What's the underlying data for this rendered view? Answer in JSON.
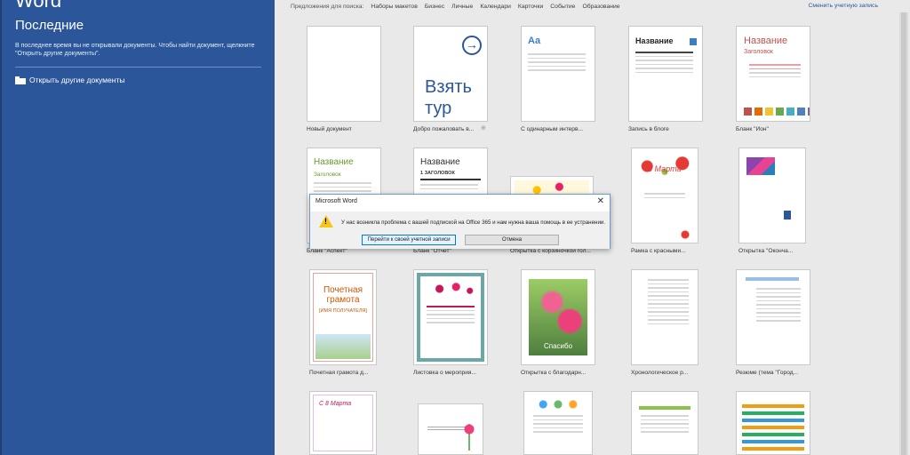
{
  "left": {
    "app_title": "Word",
    "recent_title": "Последние",
    "recent_desc": "В последнее время вы не открывали документы. Чтобы найти документ, щелкните \"Открыть другие документы\".",
    "open_other": "Открыть другие документы"
  },
  "topbar": {
    "suggest_label": "Предложения для поиска:",
    "links": [
      "Наборы макетов",
      "Бизнес",
      "Личные",
      "Календари",
      "Карточки",
      "Событие",
      "Образование"
    ],
    "switch_account": "Сменить учетную запись"
  },
  "templates": [
    {
      "caption": "Новый документ"
    },
    {
      "caption": "Добро пожаловать в...",
      "text": "Взять тур"
    },
    {
      "caption": "С одинарным интерв...",
      "text": "Aa"
    },
    {
      "caption": "Запись в блоге",
      "text": "Название"
    },
    {
      "caption": "Бланк \"Ион\"",
      "text": "Название",
      "sub": "Заголовок"
    },
    {
      "caption": "Бланк \"Аспект\"",
      "text": "Название",
      "sub": "Заголовок"
    },
    {
      "caption": "Бланк \"Отчет\"",
      "text": "Название",
      "sub": "1 ЗАГОЛОВОК"
    },
    {
      "caption": "Открытка с корзиночкой гол..."
    },
    {
      "caption": "Рамка с красными...",
      "text": "8 Марта"
    },
    {
      "caption": "Открытка \"Оконча..."
    },
    {
      "caption": "Почетная грамота д...",
      "text": "Почетная грамота",
      "sub": "[ИМЯ ПОЛУЧАТЕЛЯ]"
    },
    {
      "caption": "Листовка о мероприя..."
    },
    {
      "caption": "Открытка с благодарн...",
      "text": "Спасибо"
    },
    {
      "caption": "Хронологическое р..."
    },
    {
      "caption": "Резюме (тема \"Город..."
    },
    {
      "caption": "",
      "text": "С 8 Марта"
    },
    {
      "caption": ""
    },
    {
      "caption": ""
    },
    {
      "caption": ""
    },
    {
      "caption": ""
    }
  ],
  "dialog": {
    "title": "Microsoft Word",
    "close": "✕",
    "message": "У нас возникла проблема с вашей подпиской на Office 365 и нам нужна ваша помощь в ее устранении.",
    "primary_button": "Перейти к своей учетной записи",
    "cancel_button": "Отмена"
  },
  "colors": {
    "accent": "#2b579a",
    "ion_palette": [
      "#c0504d",
      "#e36c09",
      "#f1c232",
      "#6aa84f",
      "#4bacc6",
      "#4f81bd",
      "#8064a2"
    ]
  }
}
